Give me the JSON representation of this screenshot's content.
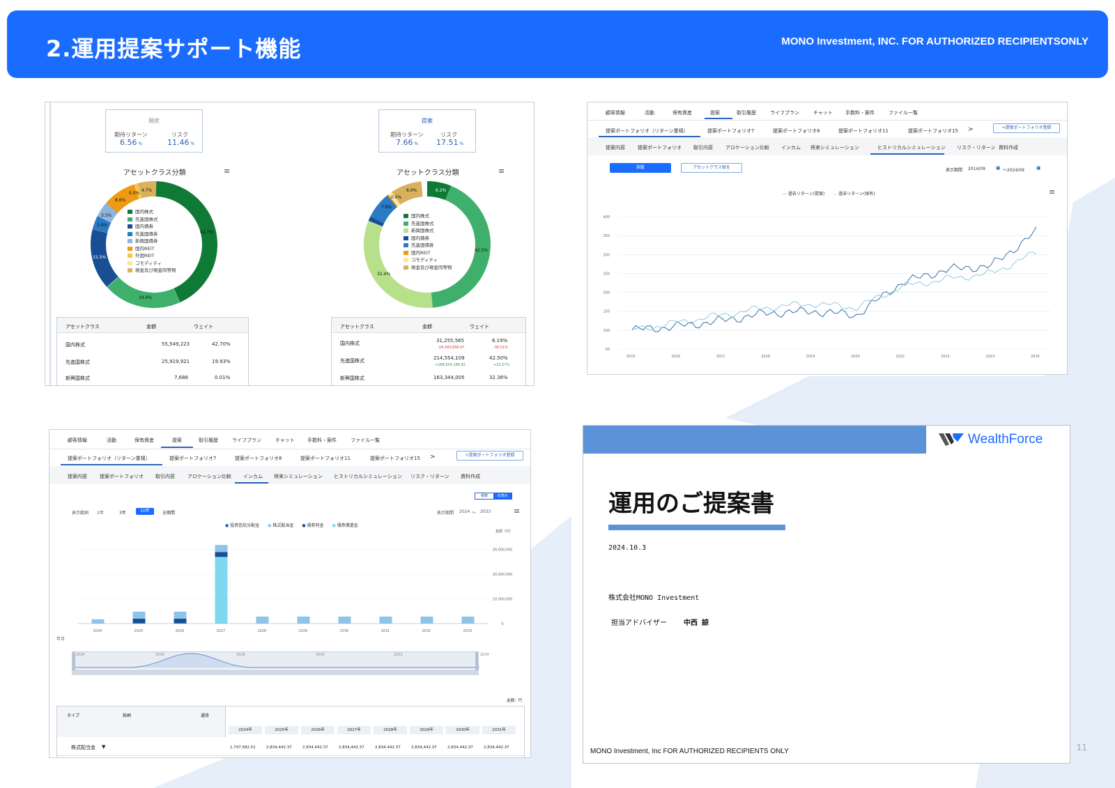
{
  "header": {
    "title": "2.運用提案サポート機能",
    "confidential": "MONO Investment, INC. FOR AUTHORIZED RECIPIENTSONLY"
  },
  "panel1": {
    "left": {
      "kpi_title": "現状",
      "ret_label": "期待リターン",
      "risk_label": "リスク",
      "ret": "6.56",
      "risk": "11.46",
      "unit": "%",
      "donut_title": "アセットクラス分類",
      "legend": [
        "国内株式",
        "先進国株式",
        "国内債券",
        "先進国債券",
        "新興国債券",
        "国内REIT",
        "外国REIT",
        "コモディティ",
        "現金及び現金同等物"
      ],
      "slice_labels": [
        "42.7%",
        "19.9%",
        "15.5%",
        "3.5%",
        "3.9%",
        "8.6%",
        "4.7%",
        "0.0%"
      ],
      "table": {
        "headers": [
          "アセットクラス",
          "金額",
          "ウェイト"
        ],
        "rows": [
          [
            "国内株式",
            "55,549,223",
            "42.70%"
          ],
          [
            "先進国株式",
            "25,919,921",
            "19.93%"
          ],
          [
            "新興国株式",
            "7,686",
            "0.01%"
          ]
        ]
      }
    },
    "right": {
      "kpi_title": "提案",
      "ret_label": "期待リターン",
      "risk_label": "リスク",
      "ret": "7.66",
      "risk": "17.51",
      "unit": "%",
      "donut_title": "アセットクラス分類",
      "legend": [
        "国内株式",
        "先進国株式",
        "新興国株式",
        "国内債券",
        "先進国債券",
        "国内REIT",
        "コモディティ",
        "現金及び現金同等物"
      ],
      "slice_labels": [
        "6.2%",
        "42.5%",
        "32.4%",
        "7.8%",
        "8.0%",
        "0.0%"
      ],
      "table": {
        "headers": [
          "アセットクラス",
          "金額",
          "ウェイト"
        ],
        "rows": [
          [
            "国内株式",
            "31,255,565",
            "6.19%",
            "-24,293,658.47",
            "-36.51%"
          ],
          [
            "先進国株式",
            "214,554,109",
            "42.50%",
            "+188,634,188.82",
            "+22.57%"
          ],
          [
            "新興国株式",
            "163,344,005",
            "32.36%"
          ]
        ]
      }
    }
  },
  "nav": {
    "tabs": [
      "顧客情報",
      "活動",
      "保有資産",
      "提案",
      "取引履歴",
      "ライフプラン",
      "チャット",
      "手数料・案件",
      "ファイル一覧"
    ],
    "portfolios": [
      "提案ポートフォリオ（リターン重視）",
      "提案ポートフォリオ7",
      "提案ポートフォリオ8",
      "提案ポートフォリオ11",
      "提案ポートフォリオ15"
    ],
    "chevron": ">",
    "register": "+提案ポートフォリオ登録",
    "sub": [
      "提案内容",
      "提案ポートフォリオ",
      "取引内容",
      "アロケーション比較",
      "インカム",
      "将来シミュレーション",
      "ヒストリカルシミュレーション",
      "リスク・リターン",
      "資料作成"
    ]
  },
  "panel2": {
    "btn_index": "指数",
    "btn_asset": "アセットクラス毎を",
    "period_label": "表示期間",
    "period_from": "2014/09",
    "period_to": "〜2024/09",
    "legend": [
      "過去リターン(提案)",
      "過去リターン(保有)"
    ],
    "chart_data": {
      "type": "line",
      "x": [
        "2015",
        "2016",
        "2017",
        "2018",
        "2019",
        "2020",
        "2021",
        "2022",
        "2023",
        "2024"
      ],
      "ylim": [
        50,
        400
      ],
      "yticks": [
        50,
        100,
        150,
        200,
        250,
        300,
        350,
        400
      ],
      "series": [
        {
          "name": "過去リターン(提案)",
          "values": [
            100,
            110,
            125,
            145,
            150,
            140,
            225,
            260,
            270,
            360
          ]
        },
        {
          "name": "過去リターン(保有)",
          "values": [
            100,
            120,
            140,
            160,
            170,
            160,
            215,
            235,
            250,
            305
          ]
        }
      ]
    }
  },
  "panel3": {
    "range_label": "表示範囲",
    "ranges": [
      "1年",
      "3年",
      "10年",
      "全期間"
    ],
    "active_range": "10年",
    "toggle": [
      "積算",
      "年表示"
    ],
    "period_label": "表示期間",
    "period_from": "2024",
    "period_tilde": "〜",
    "period_to": "2033",
    "legend": [
      "投資信託分配金",
      "株式配当金",
      "債券利金",
      "債券償還金"
    ],
    "yunit": "金額（円）",
    "xunit": "年月",
    "amount_unit": "金額：円",
    "chart_data": {
      "type": "bar",
      "categories": [
        "2024",
        "2025",
        "2026",
        "2027",
        "2028",
        "2029",
        "2030",
        "2031",
        "2032",
        "2033"
      ],
      "ylim": [
        0,
        35000000
      ],
      "yticks": [
        "0",
        "10,000,000",
        "20,000,000",
        "30,000,000"
      ],
      "series": [
        {
          "name": "投資信託分配金",
          "values": [
            0,
            0,
            0,
            0,
            0,
            0,
            0,
            0,
            0,
            0
          ]
        },
        {
          "name": "株式配当金",
          "values": [
            1747582,
            2834442,
            2834442,
            2834442,
            2834442,
            2834442,
            2834442,
            2834442,
            2834442,
            2834442
          ]
        },
        {
          "name": "債券利金",
          "values": [
            0,
            2000000,
            2000000,
            2000000,
            0,
            0,
            0,
            0,
            0,
            0
          ]
        },
        {
          "name": "債券償還金",
          "values": [
            0,
            0,
            0,
            27000000,
            0,
            0,
            0,
            0,
            0,
            0
          ]
        }
      ]
    },
    "slider_labels": [
      "2024",
      "2026",
      "2028",
      "2030",
      "2032",
      "2034"
    ],
    "table": {
      "h1": "タイプ",
      "h2": "銘柄",
      "h3": "通貨",
      "years": [
        "2024年",
        "2025年",
        "2026年",
        "2027年",
        "2028年",
        "2029年",
        "2030年",
        "2031年"
      ],
      "row_label": "株式配当金",
      "row_caret": "▼",
      "row_vals": [
        "1,747,582.51",
        "2,834,442.37",
        "2,834,442.37",
        "2,834,442.37",
        "2,834,442.37",
        "2,834,442.37",
        "2,834,442.37",
        "2,834,442.37"
      ]
    }
  },
  "panel4": {
    "brand": "WealthForce",
    "title": "運用のご提案書",
    "date": "2024.10.3",
    "company": "株式会社MONO Investment",
    "advisor_label": "担当アドバイザー",
    "advisor": "中西 諒",
    "footer": "MONO Investment, Inc FOR AUTHORIZED RECIPIENTS ONLY"
  },
  "page_number": "11"
}
